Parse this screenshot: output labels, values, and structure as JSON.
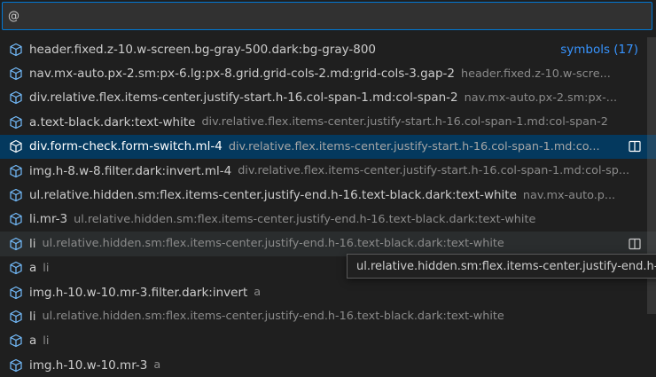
{
  "search": {
    "value": "@"
  },
  "header_meta": "symbols (17)",
  "items": [
    {
      "label": "header.fixed.z-10.w-screen.bg-gray-500.dark:bg-gray-800",
      "desc": ""
    },
    {
      "label": "nav.mx-auto.px-2.sm:px-6.lg:px-8.grid.grid-cols-2.md:grid-cols-3.gap-2",
      "desc": "header.fixed.z-10.w-scre..."
    },
    {
      "label": "div.relative.flex.items-center.justify-start.h-16.col-span-1.md:col-span-2",
      "desc": "nav.mx-auto.px-2.sm:px-..."
    },
    {
      "label": "a.text-black.dark:text-white",
      "desc": "div.relative.flex.items-center.justify-start.h-16.col-span-1.md:col-span-2"
    },
    {
      "label": "div.form-check.form-switch.ml-4",
      "desc": "div.relative.flex.items-center.justify-start.h-16.col-span-1.md:co..."
    },
    {
      "label": "img.h-8.w-8.filter.dark:invert.ml-4",
      "desc": "div.relative.flex.items-center.justify-start.h-16.col-span-1.md:col-sp..."
    },
    {
      "label": "ul.relative.hidden.sm:flex.items-center.justify-end.h-16.text-black.dark:text-white",
      "desc": "nav.mx-auto.p..."
    },
    {
      "label": "li.mr-3",
      "desc": "ul.relative.hidden.sm:flex.items-center.justify-end.h-16.text-black.dark:text-white"
    },
    {
      "label": "li",
      "desc": "ul.relative.hidden.sm:flex.items-center.justify-end.h-16.text-black.dark:text-white"
    },
    {
      "label": "a",
      "desc": "li"
    },
    {
      "label": "img.h-10.w-10.mr-3.filter.dark:invert",
      "desc": "a"
    },
    {
      "label": "li",
      "desc": "ul.relative.hidden.sm:flex.items-center.justify-end.h-16.text-black.dark:text-white"
    },
    {
      "label": "a",
      "desc": "li"
    },
    {
      "label": "img.h-10.w-10.mr-3",
      "desc": "a"
    }
  ],
  "tooltip": "ul.relative.hidden.sm:flex.items-center.justify-end.h-",
  "icons": {
    "symbol": "symbol-field-icon",
    "split": "split-editor-icon"
  },
  "colors": {
    "accent": "#0078d4",
    "focus_bg": "#04395e",
    "icon_blue": "#75beff",
    "link": "#3794ff"
  }
}
